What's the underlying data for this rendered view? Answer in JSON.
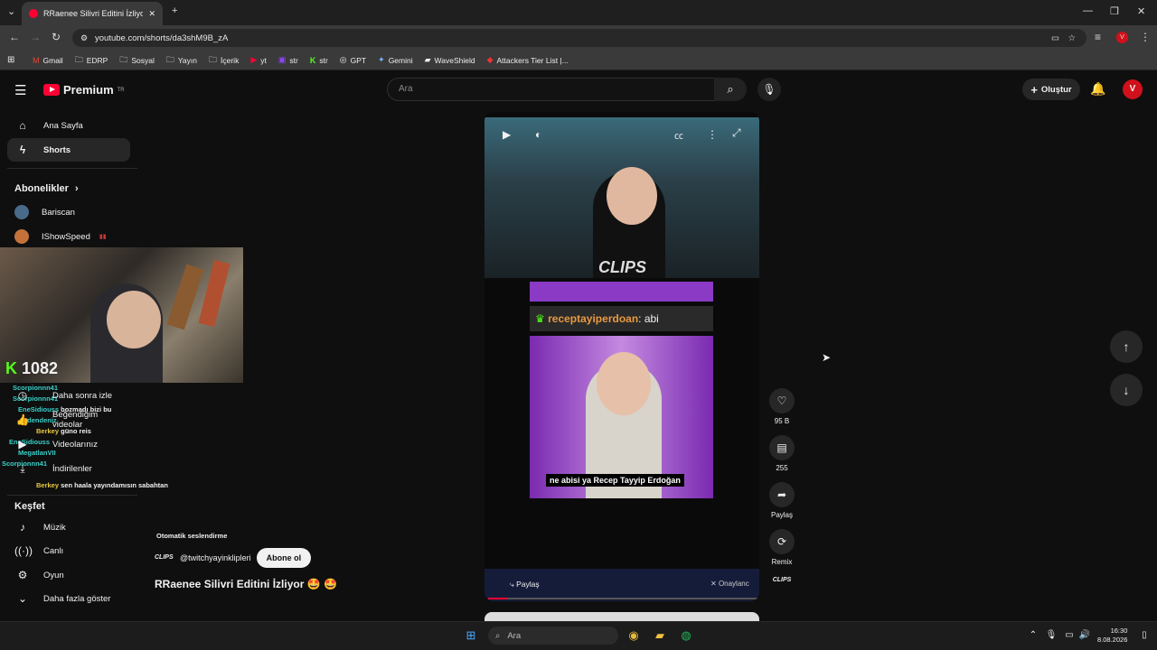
{
  "browser": {
    "tab_title": "RRaenee Silivri Editini İzliyor 🤩",
    "new_tab": "+",
    "url": "youtube.com/shorts/da3shM9B_zA",
    "bookmarks": [
      "Gmail",
      "EDRP",
      "Sosyal",
      "Yayın",
      "İçerik",
      "yt",
      "str",
      "str",
      "GPT",
      "Gemini",
      "WaveShield",
      "Attackers Tier List |..."
    ]
  },
  "header": {
    "brand": "Premium",
    "brand_sup": "TR",
    "search_placeholder": "Ara",
    "create_label": "Oluştur"
  },
  "sidebar": {
    "items": [
      {
        "label": "Ana Sayfa",
        "icon": "home-icon"
      },
      {
        "label": "Shorts",
        "icon": "shorts-icon"
      }
    ],
    "subscriptions_title": "Abonelikler",
    "subscriptions": [
      "Bariscan",
      "IShowSpeed"
    ],
    "you_items": [
      "Daha sonra izle",
      "Beğendiğim videolar",
      "Videolarınız",
      "İndirilenler"
    ],
    "explore_title": "Keşfet",
    "explore_items": [
      {
        "label": "Müzik",
        "icon": "music-icon"
      },
      {
        "label": "Canlı",
        "icon": "live-icon"
      },
      {
        "label": "Oyun",
        "icon": "game-icon"
      },
      {
        "label": "Daha fazla göster",
        "icon": "chevron-down-icon"
      }
    ]
  },
  "overlay": {
    "counter": "1082",
    "chat": [
      {
        "user": "Scorpionnn41",
        "msg": ""
      },
      {
        "user": "Scorpionnn41",
        "msg": ""
      },
      {
        "user": "EneSidiouss",
        "msg": "bozmadı bizi bu"
      },
      {
        "user": "edendeniz",
        "msg": ""
      },
      {
        "user": "Berkey",
        "msg": "güno reis"
      },
      {
        "user": "EneSidiouss",
        "msg": ""
      },
      {
        "user": "MegatlanVII",
        "msg": ""
      },
      {
        "user": "Scorpionnn41",
        "msg": ""
      },
      {
        "user": "",
        "msg": ""
      },
      {
        "user": "Berkey",
        "msg": "sen haala yayındamısın sabahtan"
      }
    ]
  },
  "video": {
    "chat_user": "receptayiperdoan",
    "chat_text": ": abi",
    "subtitle": "ne abisi ya Recep Tayyip Erdoğan",
    "share_label": "Paylaş",
    "approved_label": "Onaylanc",
    "auto_dub": "Otomatik seslendirme",
    "channel": "@twitchyayinklipleri",
    "subscribe": "Abone ol",
    "title": "RRaenee Silivri Editini İzliyor 🤩 🤩"
  },
  "actions": {
    "likes": "95 B",
    "comments": "255",
    "share": "Paylaş",
    "remix": "Remix"
  },
  "taskbar": {
    "search_placeholder": "Ara",
    "time": "16:30",
    "date": "8.08.2026"
  }
}
